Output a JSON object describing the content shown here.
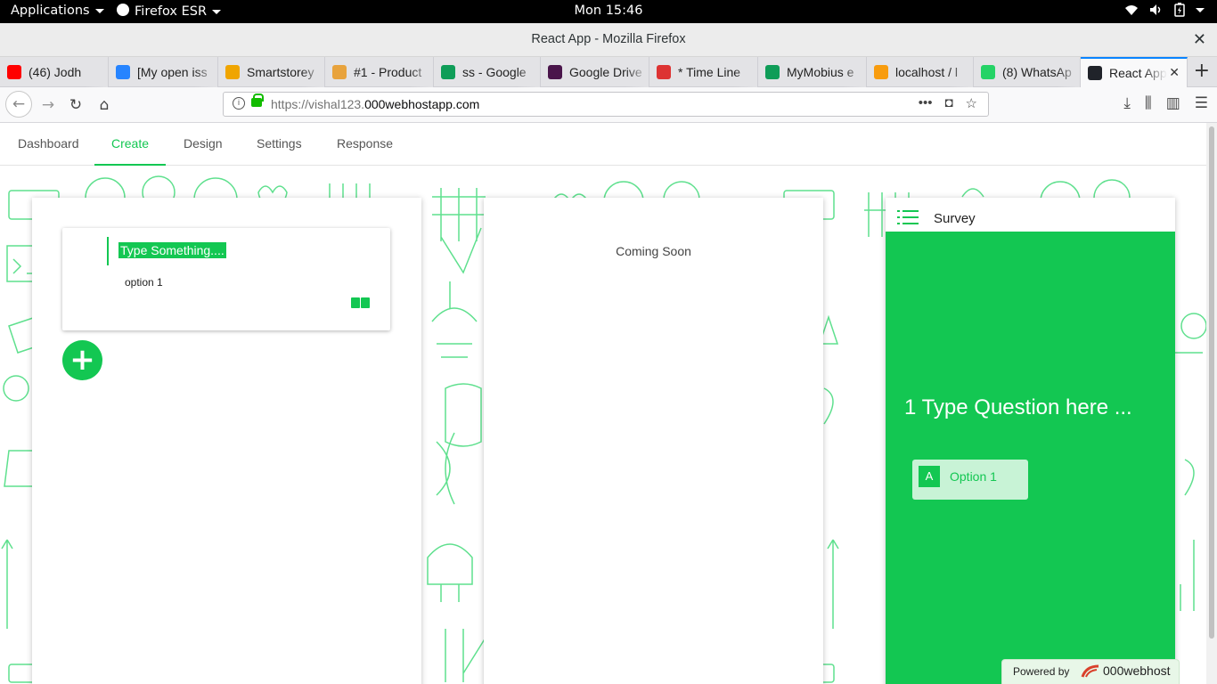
{
  "system_bar": {
    "applications": "Applications",
    "app_name": "Firefox ESR",
    "clock": "Mon 15:46"
  },
  "window": {
    "title": "React App - Mozilla Firefox"
  },
  "browser_tabs": [
    {
      "label": "(46) Jodh",
      "icon": "youtube-icon",
      "color": "#ff0000"
    },
    {
      "label": "[My open iss",
      "icon": "jira-icon",
      "color": "#2684ff"
    },
    {
      "label": "Smartstorey",
      "icon": "smartstorey-icon",
      "color": "#f0a500"
    },
    {
      "label": "#1 - Product",
      "icon": "product-icon",
      "color": "#e8a33d"
    },
    {
      "label": "ss - Google",
      "icon": "google-sheets-icon",
      "color": "#0f9d58"
    },
    {
      "label": "Google Drive",
      "icon": "slack-icon",
      "color": "#4a154b"
    },
    {
      "label": "* Time Line",
      "icon": "timeline-icon",
      "color": "#d33"
    },
    {
      "label": "MyMobius e",
      "icon": "google-sheets-icon",
      "color": "#0f9d58"
    },
    {
      "label": "localhost / l",
      "icon": "phpmyadmin-icon",
      "color": "#f89c0e"
    },
    {
      "label": "(8) WhatsAp",
      "icon": "whatsapp-icon",
      "color": "#25d366"
    },
    {
      "label": "React App",
      "icon": "react-icon",
      "color": "#20232a"
    }
  ],
  "urlbar": {
    "url_prefix": "https://vishal123.",
    "url_domain": "000webhostapp.com"
  },
  "app_tabs": [
    "Dashboard",
    "Create",
    "Design",
    "Settings",
    "Response"
  ],
  "active_app_tab": "Create",
  "editor": {
    "question_placeholder": "Type Something....",
    "option_1": "option 1",
    "add_label": "+"
  },
  "design_panel": {
    "message": "Coming Soon"
  },
  "survey_preview": {
    "title": "Survey",
    "question": "1 Type Question here ...",
    "option_key": "A",
    "option_label": "Option 1"
  },
  "footer": {
    "powered_by": "Powered by",
    "brand": "000webhost"
  },
  "colors": {
    "accent": "#13c752",
    "option_bg": "#c8f3d6"
  }
}
